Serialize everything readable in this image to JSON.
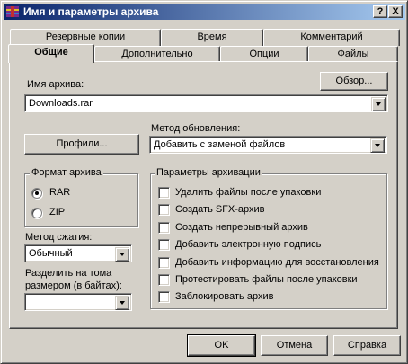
{
  "window": {
    "title": "Имя и параметры архива",
    "help_button": "?",
    "close_button": "X"
  },
  "tabs": {
    "row_back": [
      "Резервные копии",
      "Время",
      "Комментарий"
    ],
    "row_front": [
      "Общие",
      "Дополнительно",
      "Опции",
      "Файлы"
    ],
    "active": "Общие"
  },
  "archive_name": {
    "label": "Имя архива:",
    "value": "Downloads.rar",
    "browse_button": "Обзор..."
  },
  "profiles_button": "Профили...",
  "update_method": {
    "label": "Метод обновления:",
    "value": "Добавить с заменой файлов"
  },
  "archive_format": {
    "title": "Формат архива",
    "options": [
      "RAR",
      "ZIP"
    ],
    "selected": "RAR"
  },
  "compression": {
    "label": "Метод сжатия:",
    "value": "Обычный"
  },
  "split": {
    "label_line1": "Разделить на тома",
    "label_line2": "размером (в байтах):",
    "value": ""
  },
  "archive_options": {
    "title": "Параметры архивации",
    "items": [
      {
        "label": "Удалить файлы после упаковки",
        "checked": false
      },
      {
        "label": "Создать SFX-архив",
        "checked": false
      },
      {
        "label": "Создать непрерывный архив",
        "checked": false
      },
      {
        "label": "Добавить электронную подпись",
        "checked": false
      },
      {
        "label": "Добавить информацию для восстановления",
        "checked": false
      },
      {
        "label": "Протестировать файлы после упаковки",
        "checked": false
      },
      {
        "label": "Заблокировать архив",
        "checked": false
      }
    ]
  },
  "footer": {
    "ok": "OK",
    "cancel": "Отмена",
    "help": "Справка"
  },
  "colors": {
    "face": "#d4d0c8",
    "title_start": "#0a246a",
    "title_end": "#a6caf0"
  }
}
